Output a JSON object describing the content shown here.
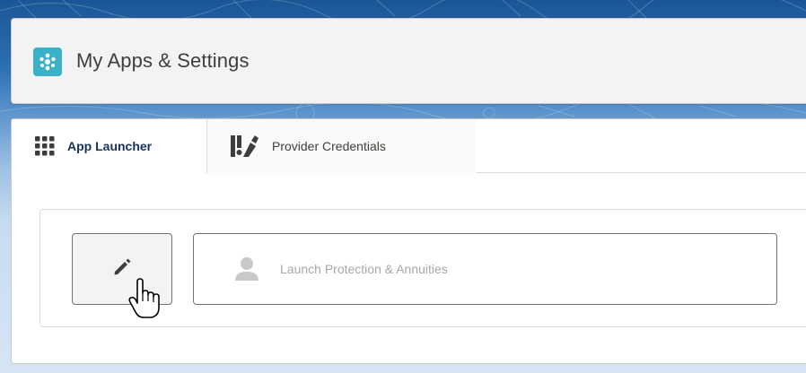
{
  "header": {
    "title": "My Apps & Settings",
    "app_icon": "app-logo-icon",
    "accent_color": "#3ab1c8"
  },
  "tabs": [
    {
      "label": "App Launcher",
      "icon": "app-grid-icon",
      "active": true
    },
    {
      "label": "Provider Credentials",
      "icon": "credentials-icon",
      "active": false
    }
  ],
  "launcher": {
    "edit_icon": "pencil-icon",
    "launch_label": "Launch Protection & Annuities",
    "launch_icon": "person-icon"
  },
  "cursor": "hand-pointer-icon"
}
